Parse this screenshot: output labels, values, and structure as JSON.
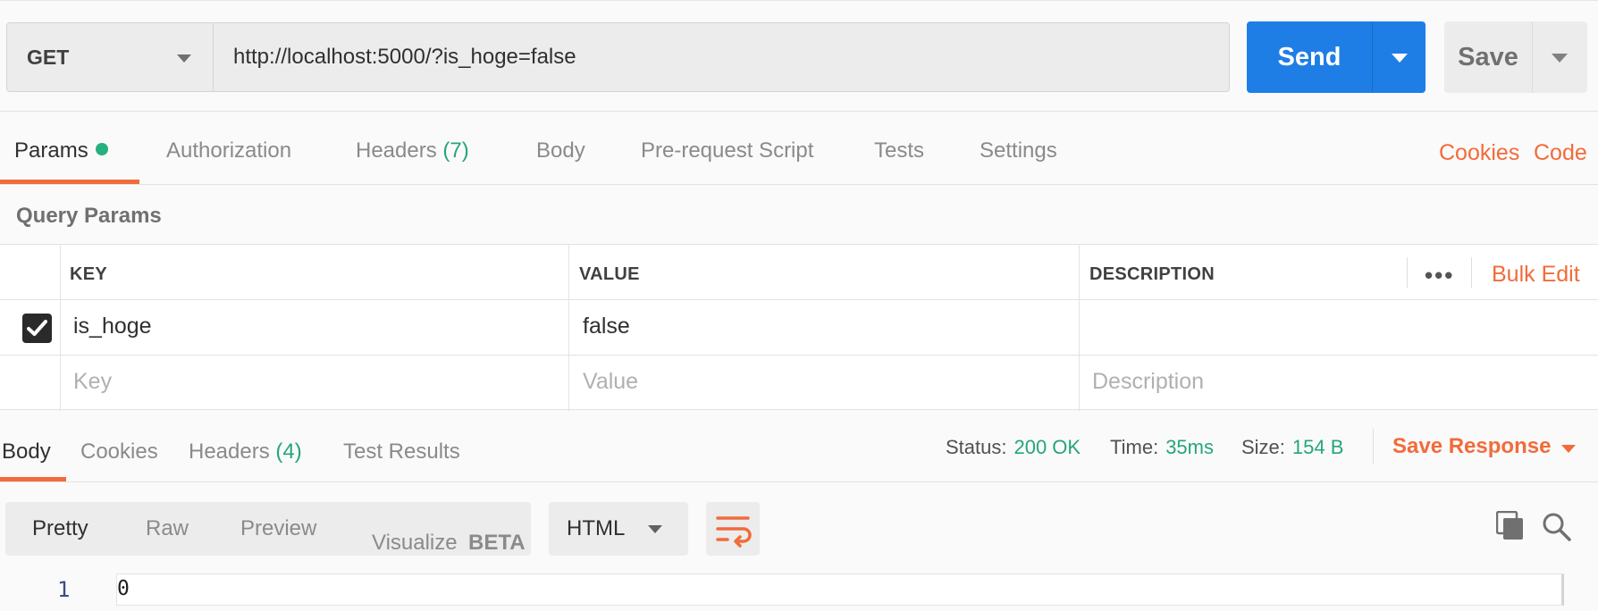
{
  "request": {
    "method": "GET",
    "url": "http://localhost:5000/?is_hoge=false",
    "send_label": "Send",
    "save_label": "Save"
  },
  "tabs": [
    {
      "label": "Params",
      "active": true
    },
    {
      "label": "Authorization"
    },
    {
      "label": "Headers",
      "count": "(7)"
    },
    {
      "label": "Body"
    },
    {
      "label": "Pre-request Script"
    },
    {
      "label": "Tests"
    },
    {
      "label": "Settings"
    }
  ],
  "right_links": {
    "cookies": "Cookies",
    "code": "Code"
  },
  "query": {
    "title": "Query Params",
    "headers": {
      "key": "KEY",
      "value": "VALUE",
      "description": "DESCRIPTION"
    },
    "bulk_edit": "Bulk Edit",
    "more": "•••",
    "rows": [
      {
        "checked": true,
        "key": "is_hoge",
        "value": "false",
        "description": ""
      }
    ],
    "placeholders": {
      "key": "Key",
      "value": "Value",
      "description": "Description"
    }
  },
  "response": {
    "tabs": [
      {
        "label": "Body",
        "active": true
      },
      {
        "label": "Cookies"
      },
      {
        "label": "Headers",
        "count": "(4)"
      },
      {
        "label": "Test Results"
      }
    ],
    "status_label": "Status:",
    "status_value": "200 OK",
    "time_label": "Time:",
    "time_value": "35ms",
    "size_label": "Size:",
    "size_value": "154 B",
    "save_response": "Save Response",
    "views": [
      "Pretty",
      "Raw",
      "Preview",
      "Visualize"
    ],
    "beta": "BETA",
    "format": "HTML",
    "lines": [
      {
        "no": "1",
        "text": "0"
      }
    ]
  },
  "colors": {
    "accent": "#f26b3a",
    "send": "#1f7ee6",
    "success": "#26a57a"
  }
}
